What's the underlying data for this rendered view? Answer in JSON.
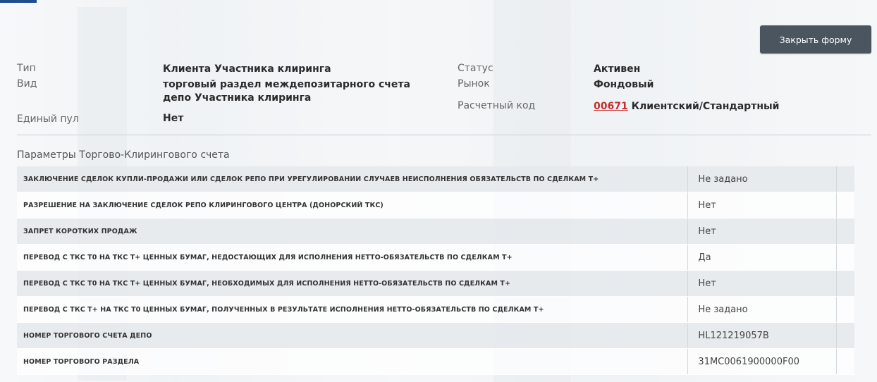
{
  "actions": {
    "close_label": "Закрыть форму"
  },
  "info": {
    "type_label": "Тип",
    "type_value": "Клиента Участника клиринга",
    "kind_label": "Вид",
    "kind_value_line1": "торговый раздел междепозитарного счета",
    "kind_value_line2": "депо Участника клиринга",
    "pool_label": "Единый пул",
    "pool_value": "Нет",
    "status_label": "Статус",
    "status_value": "Активен",
    "market_label": "Рынок",
    "market_value": "Фондовый",
    "code_label": "Расчетный код",
    "code_number": "00671",
    "code_text": "Клиентский/Стандартный"
  },
  "section": {
    "title": "Параметры Торгово-Клирингового счета"
  },
  "params": [
    {
      "name": "Заключение сделок купли-продажи или сделок РЕПО при урегулировании случаев неисполнения обязательств по сделкам Т+",
      "value": "Не задано"
    },
    {
      "name": "Разрешение на заключение сделок РЕПО Клирингового центра (донорский ТКС)",
      "value": "Нет"
    },
    {
      "name": "Запрет коротких продаж",
      "value": "Нет"
    },
    {
      "name": "Перевод с ТКС Т0 на ТКС Т+ ценных бумаг, недостающих для исполнения нетто-обязательств по сделкам Т+",
      "value": "Да"
    },
    {
      "name": "Перевод с ТКС Т0 на ТКС Т+ ценных бумаг, необходимых для исполнения нетто-обязательств по сделкам Т+",
      "value": "Нет"
    },
    {
      "name": "Перевод с ТКС Т+ на ТКС Т0 ценных бумаг, полученных в результате исполнения нетто-обязательств по сделкам Т+",
      "value": "Не задано"
    },
    {
      "name": "Номер торгового счета депо",
      "value": "HL121219057B"
    },
    {
      "name": "Номер торгового раздела",
      "value": "31MC0061900000F00"
    }
  ]
}
